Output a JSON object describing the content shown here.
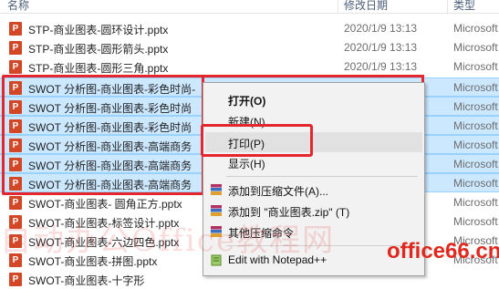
{
  "header": {
    "name": "名称",
    "date": "修改日期",
    "type": "类型"
  },
  "files": [
    {
      "name": "STP-商业图表-圆环设计.pptx",
      "date": "2020/1/9 13:13",
      "type": "Microsoft"
    },
    {
      "name": "STP-商业图表-圆形箭头.pptx",
      "date": "2020/1/9 13:13",
      "type": "Microsoft"
    },
    {
      "name": "STP-商业图表-圆形三角.pptx",
      "date": "2020/1/9 13:13",
      "type": "Microsoft"
    },
    {
      "name": "SWOT 分析图-商业图表-彩色时尚-",
      "date": "",
      "type": "Microsoft"
    },
    {
      "name": "SWOT 分析图-商业图表-彩色时尚",
      "date": "",
      "type": "Microsoft"
    },
    {
      "name": "SWOT 分析图-商业图表-彩色时尚",
      "date": "",
      "type": "Microsoft"
    },
    {
      "name": "SWOT 分析图-商业图表-高端商务",
      "date": "",
      "type": "Microsoft"
    },
    {
      "name": "SWOT 分析图-商业图表-高端商务",
      "date": "",
      "type": "Microsoft"
    },
    {
      "name": "SWOT 分析图-商业图表-高端商务",
      "date": "",
      "type": "Microsoft"
    },
    {
      "name": "SWOT-商业图表- 圆角正方.pptx",
      "date": "",
      "type": "Microsoft"
    },
    {
      "name": "SWOT-商业图表-标签设计.pptx",
      "date": "",
      "type": "Microsoft"
    },
    {
      "name": "SWOT-商业图表-六边四色.pptx",
      "date": "",
      "type": "Microsoft"
    },
    {
      "name": "SWOT-商业图表-拼图.pptx",
      "date": "",
      "type": "Microsoft"
    },
    {
      "name": "SWOT-商业图表-十字形",
      "date": "",
      "type": ""
    }
  ],
  "menu": {
    "open": "打开(O)",
    "new": "新建(N)",
    "print": "打印(P)",
    "show": "显示(H)",
    "add_archive": "添加到压缩文件(A)...",
    "add_zip": "添加到 \"商业图表.zip\" (T)",
    "other_compress": "其他压缩命令",
    "notepad": "Edit with Notepad++"
  },
  "watermark": {
    "main": "自动办公Office教程网",
    "site": "office66.cn"
  },
  "colors": {
    "selection": "#cce8ff",
    "highlight_box": "#e5262e",
    "ppt_icon": "#d24726"
  }
}
